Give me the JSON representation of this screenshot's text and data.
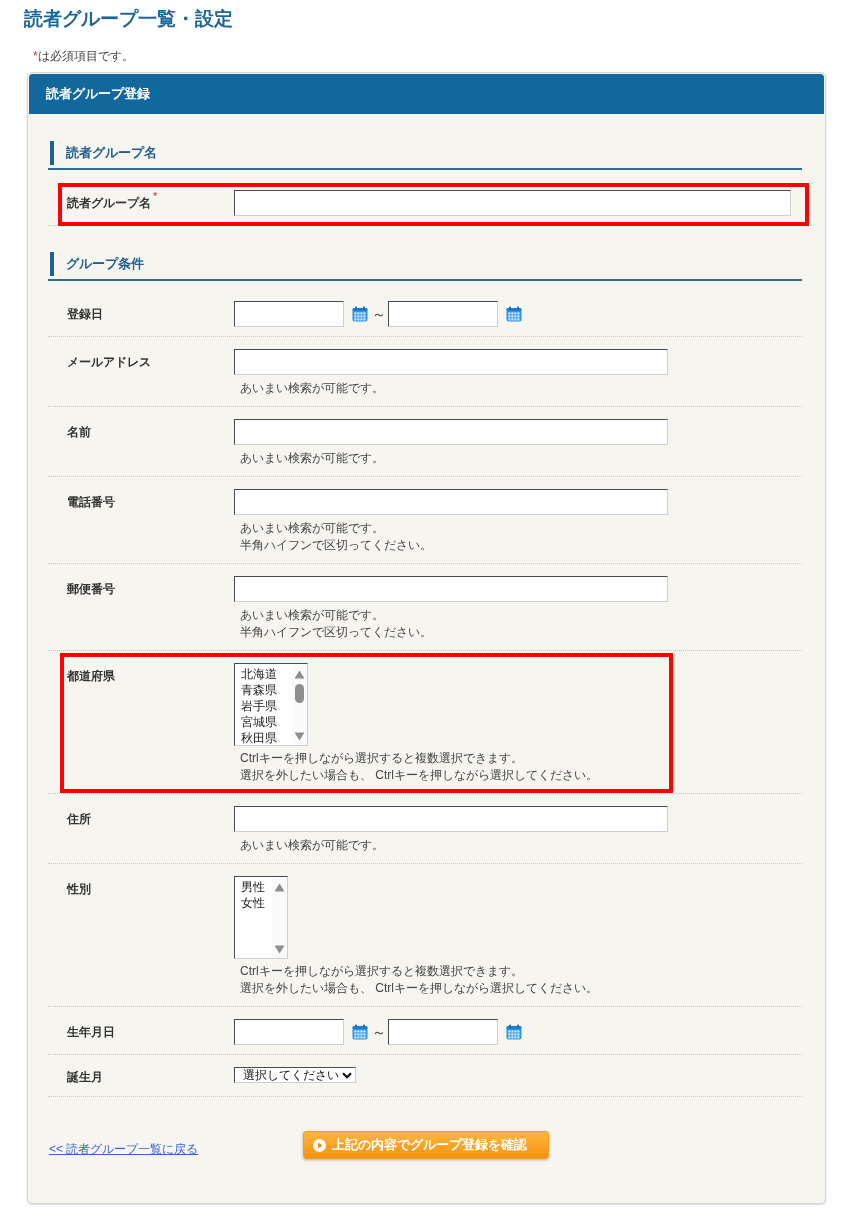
{
  "page_title": "読者グループ一覧・設定",
  "required_note": {
    "mark": "*",
    "text": "は必須項目です。"
  },
  "panel": {
    "title": "読者グループ登録",
    "sections": [
      {
        "heading": "読者グループ名",
        "rows": [
          {
            "kind": "text",
            "label": "読者グループ名",
            "required_mark": "*",
            "highlighted": true
          }
        ]
      },
      {
        "heading": "グループ条件",
        "rows": [
          {
            "kind": "date_range",
            "label": "登録日",
            "separator": "～",
            "highlighted": false
          },
          {
            "kind": "text",
            "label": "メールアドレス",
            "hints": [
              "あいまい検索が可能です。"
            ],
            "highlighted": false
          },
          {
            "kind": "text",
            "label": "名前",
            "hints": [
              "あいまい検索が可能です。"
            ],
            "highlighted": false
          },
          {
            "kind": "text",
            "label": "電話番号",
            "hints": [
              "あいまい検索が可能です。",
              "半角ハイフンで区切ってください。"
            ],
            "highlighted": false
          },
          {
            "kind": "text",
            "label": "郵便番号",
            "hints": [
              "あいまい検索が可能です。",
              "半角ハイフンで区切ってください。"
            ],
            "highlighted": false
          },
          {
            "kind": "listbox",
            "label": "都道府県",
            "scrollable": true,
            "options": [
              {
                "label": "北海道",
                "selected": false
              },
              {
                "label": "青森県",
                "selected": false
              },
              {
                "label": "岩手県",
                "selected": false
              },
              {
                "label": "宮城県",
                "selected": false
              },
              {
                "label": "秋田県",
                "selected": false
              }
            ],
            "hints": [
              "Ctrlキーを押しながら選択すると複数選択できます。",
              "選択を外したい場合も、 Ctrlキーを押しながら選択してください。"
            ],
            "highlighted": true
          },
          {
            "kind": "text",
            "label": "住所",
            "hints": [
              "あいまい検索が可能です。"
            ],
            "highlighted": false
          },
          {
            "kind": "listbox",
            "label": "性別",
            "scrollable": false,
            "options": [
              {
                "label": "男性",
                "selected": false
              },
              {
                "label": "女性",
                "selected": false
              }
            ],
            "hints": [
              "Ctrlキーを押しながら選択すると複数選択できます。",
              "選択を外したい場合も、 Ctrlキーを押しながら選択してください。"
            ],
            "highlighted": false
          },
          {
            "kind": "date_range",
            "label": "生年月日",
            "separator": "～",
            "highlighted": false
          },
          {
            "kind": "select",
            "label": "誕生月",
            "value": "選択してください",
            "highlighted": false
          }
        ]
      }
    ],
    "back_link": "<< 読者グループ一覧に戻る",
    "confirm_button": "上記の内容でグループ登録を確認"
  }
}
